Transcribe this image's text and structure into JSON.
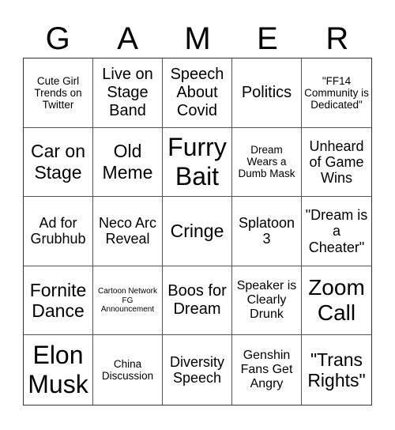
{
  "title_letters": [
    "G",
    "A",
    "M",
    "E",
    "R"
  ],
  "cells": [
    "Cute Girl Trends on Twitter",
    "Live on Stage Band",
    "Speech About Covid",
    "Politics",
    "\"FF14 Community is Dedicated\"",
    "Car on Stage",
    "Old Meme",
    "Furry Bait",
    "Dream Wears a Dumb Mask",
    "Unheard of Game Wins",
    "Ad for Grubhub",
    "Neco Arc Reveal",
    "Cringe",
    "Splatoon 3",
    "\"Dream is a Cheater\"",
    "Fornite Dance",
    "Cartoon Network FG Announcement",
    "Boos for Dream",
    "Speaker is Clearly Drunk",
    "Zoom Call",
    "Elon Musk",
    "China Discussion",
    "Diversity Speech",
    "Genshin Fans Get Angry",
    "\"Trans Rights\""
  ],
  "colors": {
    "grid_line": "#555555",
    "text": "#000000",
    "background": "#ffffff"
  }
}
